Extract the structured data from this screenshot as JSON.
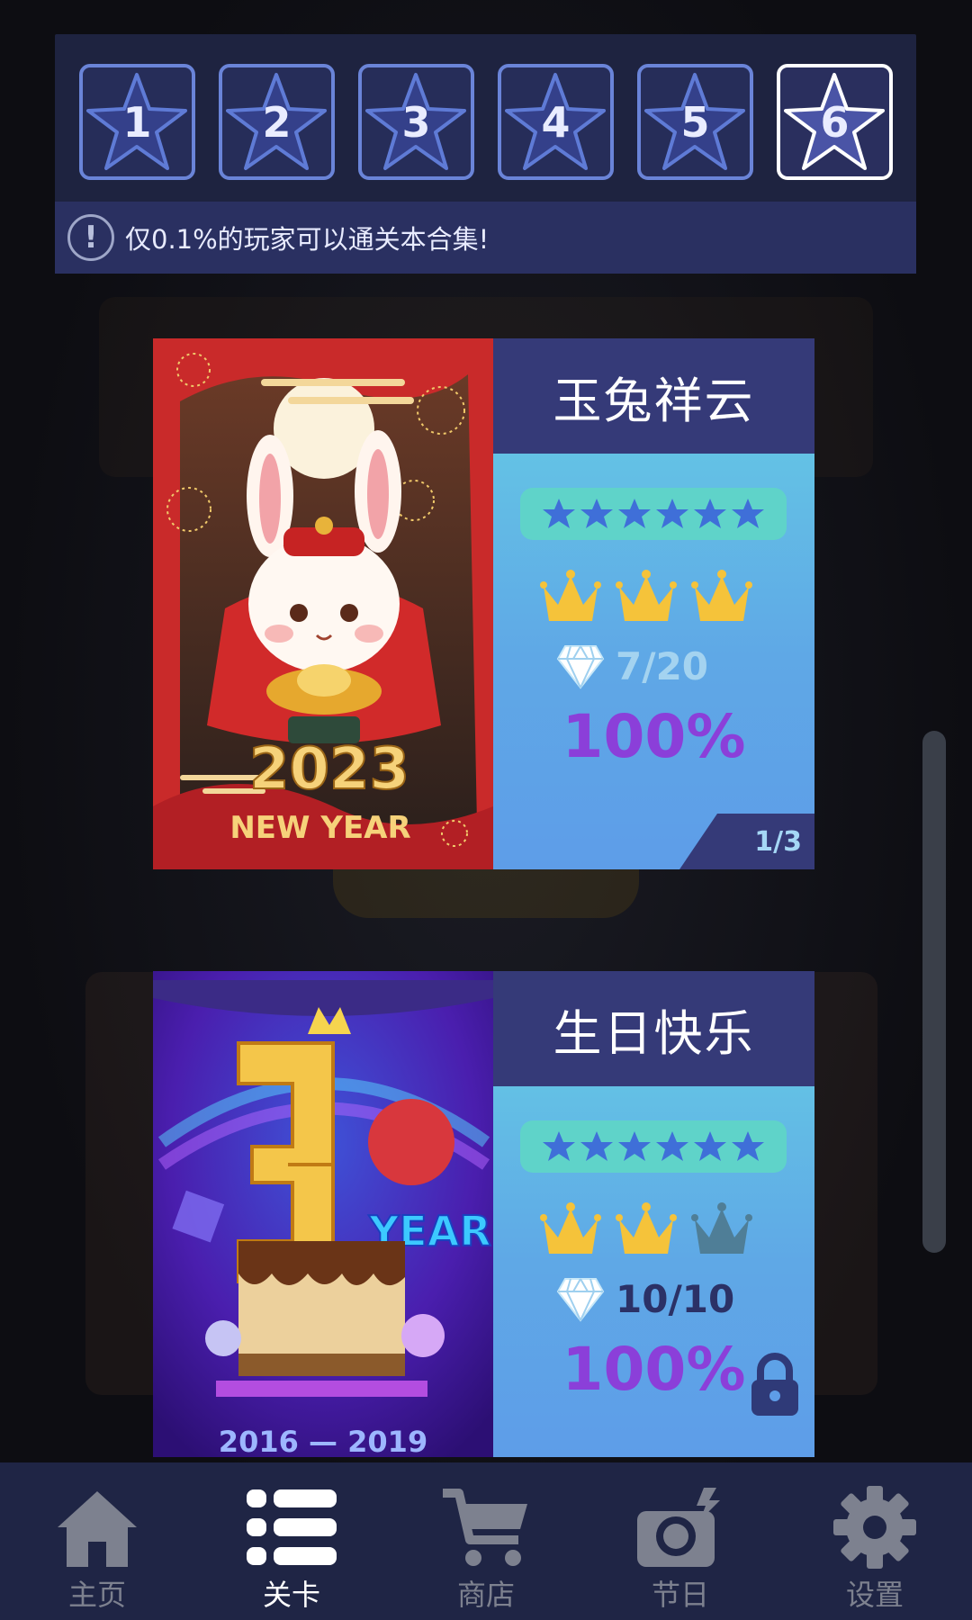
{
  "levels": {
    "items": [
      {
        "label": "1",
        "active": false
      },
      {
        "label": "2",
        "active": false
      },
      {
        "label": "3",
        "active": false
      },
      {
        "label": "4",
        "active": false
      },
      {
        "label": "5",
        "active": false
      },
      {
        "label": "6",
        "active": true
      }
    ],
    "notice": "仅0.1%的玩家可以通关本合集!"
  },
  "cards": [
    {
      "title": "玉兔祥云",
      "art_text_year": "2023",
      "art_text_caption": "NEW YEAR",
      "stars": 6,
      "crowns": [
        "gold",
        "gold",
        "gold"
      ],
      "gems": "7/20",
      "gems_color": "#a4d3f0",
      "percent": "100%",
      "page": "1/3",
      "locked": false
    },
    {
      "title": "生日快乐",
      "art_text_big": "3",
      "art_text_caption": "YEARS",
      "art_text_range": "2016 — 2019",
      "stars": 6,
      "crowns": [
        "gold",
        "gold",
        "gray"
      ],
      "gems": "10/10",
      "gems_color": "#2b3166",
      "percent": "100%",
      "locked": true
    }
  ],
  "nav": {
    "items": [
      {
        "label": "主页",
        "icon": "home-icon",
        "active": false
      },
      {
        "label": "关卡",
        "icon": "list-icon",
        "active": true
      },
      {
        "label": "商店",
        "icon": "cart-icon",
        "active": false
      },
      {
        "label": "节日",
        "icon": "festival-icon",
        "active": false
      },
      {
        "label": "设置",
        "icon": "gear-icon",
        "active": false
      }
    ]
  },
  "colors": {
    "crown_gold": "#f5c33a",
    "crown_gray": "#4f7e97",
    "star_blue": "#3f6fd8",
    "percent_purple": "#8b3fd9"
  }
}
